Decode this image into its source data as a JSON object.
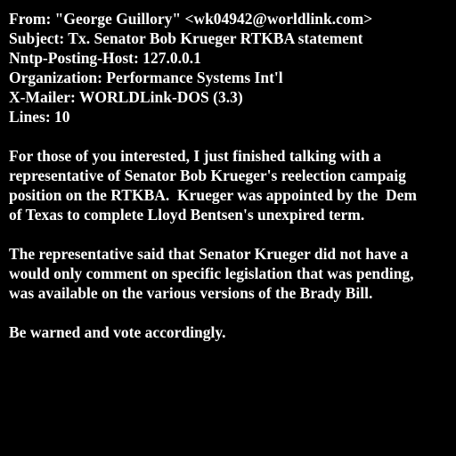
{
  "headers": {
    "from": "From: \"George Guillory\" <wk04942@worldlink.com>",
    "subject": "Subject: Tx. Senator Bob Krueger RTKBA statement",
    "nntp_posting_host": "Nntp-Posting-Host: 127.0.0.1",
    "organization": "Organization: Performance Systems Int'l",
    "x_mailer": "X-Mailer: WORLDLink-DOS (3.3)",
    "lines": "Lines: 10"
  },
  "body": {
    "paragraph1": [
      "For those of you interested, I just finished talking with a",
      "representative of Senator Bob Krueger's reelection campaig",
      "position on the RTKBA.  Krueger was appointed by the  Dem",
      "of Texas to complete Lloyd Bentsen's unexpired term."
    ],
    "paragraph2": [
      "The representative said that Senator Krueger did not have a",
      "would only comment on specific legislation that was pending,",
      "was available on the various versions of the Brady Bill."
    ],
    "paragraph3": [
      "Be warned and vote accordingly."
    ]
  },
  "colors": {
    "background": "#000000",
    "text": "#ffffff"
  }
}
